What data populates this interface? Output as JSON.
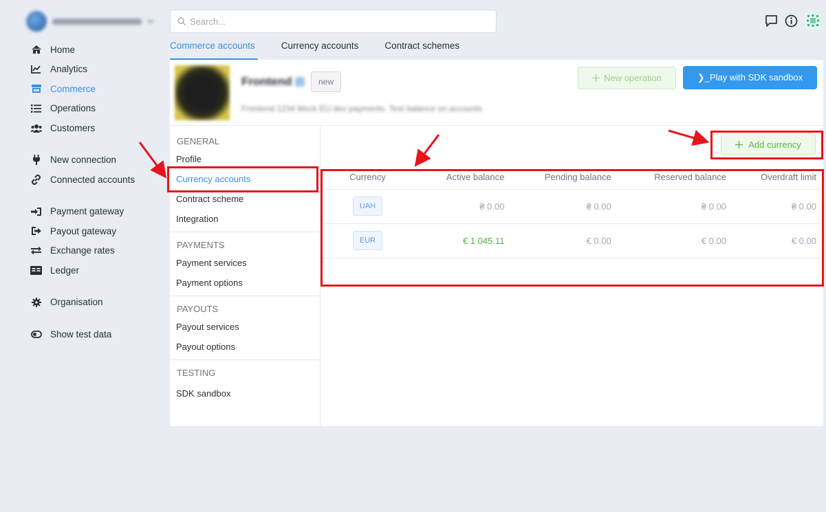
{
  "org": {
    "name": "Merchant Inc. TEST"
  },
  "search": {
    "placeholder": "Search..."
  },
  "sidebar": {
    "items": [
      {
        "label": "Home",
        "icon": "home-icon"
      },
      {
        "label": "Analytics",
        "icon": "analytics-icon"
      },
      {
        "label": "Commerce",
        "icon": "store-icon",
        "active": true
      },
      {
        "label": "Operations",
        "icon": "list-icon"
      },
      {
        "label": "Customers",
        "icon": "users-icon"
      },
      {
        "label": "New connection",
        "icon": "plug-icon"
      },
      {
        "label": "Connected accounts",
        "icon": "link-icon"
      },
      {
        "label": "Payment gateway",
        "icon": "sign-in-icon"
      },
      {
        "label": "Payout gateway",
        "icon": "sign-out-icon"
      },
      {
        "label": "Exchange rates",
        "icon": "exchange-icon"
      },
      {
        "label": "Ledger",
        "icon": "ledger-icon"
      },
      {
        "label": "Organisation",
        "icon": "gear-icon"
      },
      {
        "label": "Show test data",
        "icon": "toggle-icon"
      }
    ]
  },
  "tabs": [
    {
      "label": "Commerce accounts",
      "active": true
    },
    {
      "label": "Currency accounts"
    },
    {
      "label": "Contract schemes"
    }
  ],
  "header": {
    "shop_name": "Frontend",
    "badge": "new",
    "description": "Frontend 1234 Mock EU dev payments. Test balance on accounts",
    "new_operation": "New operation",
    "sdk_button": "❯_Play with SDK sandbox"
  },
  "subnav": {
    "general": "GENERAL",
    "profile": "Profile",
    "currency_accounts": "Currency accounts",
    "contract_scheme": "Contract scheme",
    "integration": "Integration",
    "payments": "PAYMENTS",
    "payment_services": "Payment services",
    "payment_options": "Payment options",
    "payouts": "PAYOUTS",
    "payout_services": "Payout services",
    "payout_options": "Payout options",
    "testing": "TESTING",
    "sdk_sandbox": "SDK sandbox"
  },
  "content": {
    "add_currency": "Add currency",
    "columns": [
      "Currency",
      "Active balance",
      "Pending balance",
      "Reserved balance",
      "Overdraft limit"
    ],
    "rows": [
      {
        "currency": "UAH",
        "active": "₴ 0.00",
        "pending": "₴ 0.00",
        "reserved": "₴ 0.00",
        "overdraft": "₴ 0.00"
      },
      {
        "currency": "EUR",
        "active": "€ 1 045.11",
        "pending": "€ 0.00",
        "reserved": "€ 0.00",
        "overdraft": "€ 0.00"
      }
    ]
  },
  "colors": {
    "accent": "#3d8fe0",
    "primary_button": "#3399ee",
    "positive": "#55b03f",
    "annotation": "#e8141b"
  }
}
